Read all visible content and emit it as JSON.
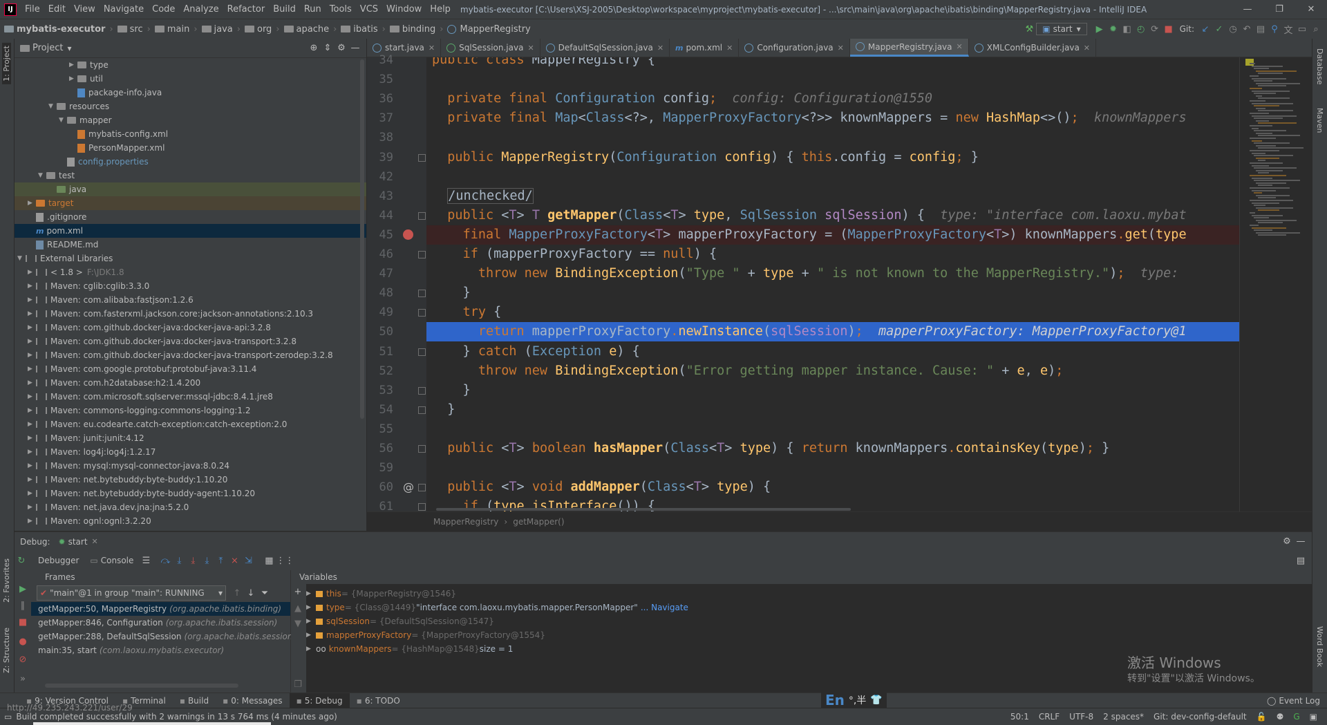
{
  "window": {
    "title": "mybatis-executor [C:\\Users\\XSJ-2005\\Desktop\\workspace\\myproject\\mybatis-executor] - ...\\src\\main\\java\\org\\apache\\ibatis\\binding\\MapperRegistry.java - IntelliJ IDEA",
    "logo": "IJ"
  },
  "menu": [
    "File",
    "Edit",
    "View",
    "Navigate",
    "Code",
    "Analyze",
    "Refactor",
    "Build",
    "Run",
    "Tools",
    "VCS",
    "Window",
    "Help"
  ],
  "breadcrumb": {
    "project": "mybatis-executor",
    "items": [
      "src",
      "main",
      "java",
      "org",
      "apache",
      "ibatis",
      "binding",
      "MapperRegistry"
    ]
  },
  "toolbar": {
    "run_config": "start",
    "git_label": "Git:"
  },
  "left_strip": {
    "project": "1: Project",
    "favorites": "2: Favorites",
    "structure": "Z: Structure"
  },
  "right_strip": {
    "database": "Database",
    "maven": "Maven",
    "wordbook": "Word Book"
  },
  "project_panel": {
    "title": "Project",
    "rows": [
      {
        "label": "type",
        "indent": 5,
        "kind": "folder",
        "arrow": "▶"
      },
      {
        "label": "util",
        "indent": 5,
        "kind": "folder",
        "arrow": "▶"
      },
      {
        "label": "package-info.java",
        "indent": 5,
        "kind": "java",
        "arrow": ""
      },
      {
        "label": "resources",
        "indent": 3,
        "kind": "folder",
        "arrow": "▼"
      },
      {
        "label": "mapper",
        "indent": 4,
        "kind": "folder",
        "arrow": "▼"
      },
      {
        "label": "mybatis-config.xml",
        "indent": 5,
        "kind": "xml",
        "arrow": ""
      },
      {
        "label": "PersonMapper.xml",
        "indent": 5,
        "kind": "xml",
        "arrow": ""
      },
      {
        "label": "config.properties",
        "indent": 4,
        "kind": "props",
        "arrow": ""
      },
      {
        "label": "test",
        "indent": 2,
        "kind": "folder",
        "arrow": "▼"
      },
      {
        "label": "java",
        "indent": 3,
        "kind": "folder-green",
        "arrow": "",
        "style": "test"
      },
      {
        "label": "target",
        "indent": 1,
        "kind": "folder-orange",
        "arrow": "▶",
        "style": "target"
      },
      {
        "label": ".gitignore",
        "indent": 1,
        "kind": "txt",
        "arrow": ""
      },
      {
        "label": "pom.xml",
        "indent": 1,
        "kind": "maven",
        "arrow": "",
        "style": "sel"
      },
      {
        "label": "README.md",
        "indent": 1,
        "kind": "md",
        "arrow": ""
      },
      {
        "label": "External Libraries",
        "indent": 0,
        "kind": "lib",
        "arrow": "▼"
      },
      {
        "label": "< 1.8 >",
        "suffix": "F:\\JDK1.8",
        "indent": 1,
        "kind": "lib",
        "arrow": "▶"
      },
      {
        "label": "Maven: cglib:cglib:3.3.0",
        "indent": 1,
        "kind": "lib",
        "arrow": "▶"
      },
      {
        "label": "Maven: com.alibaba:fastjson:1.2.6",
        "indent": 1,
        "kind": "lib",
        "arrow": "▶"
      },
      {
        "label": "Maven: com.fasterxml.jackson.core:jackson-annotations:2.10.3",
        "indent": 1,
        "kind": "lib",
        "arrow": "▶"
      },
      {
        "label": "Maven: com.github.docker-java:docker-java-api:3.2.8",
        "indent": 1,
        "kind": "lib",
        "arrow": "▶"
      },
      {
        "label": "Maven: com.github.docker-java:docker-java-transport:3.2.8",
        "indent": 1,
        "kind": "lib",
        "arrow": "▶"
      },
      {
        "label": "Maven: com.github.docker-java:docker-java-transport-zerodep:3.2.8",
        "indent": 1,
        "kind": "lib",
        "arrow": "▶"
      },
      {
        "label": "Maven: com.google.protobuf:protobuf-java:3.11.4",
        "indent": 1,
        "kind": "lib",
        "arrow": "▶"
      },
      {
        "label": "Maven: com.h2database:h2:1.4.200",
        "indent": 1,
        "kind": "lib",
        "arrow": "▶"
      },
      {
        "label": "Maven: com.microsoft.sqlserver:mssql-jdbc:8.4.1.jre8",
        "indent": 1,
        "kind": "lib",
        "arrow": "▶"
      },
      {
        "label": "Maven: commons-logging:commons-logging:1.2",
        "indent": 1,
        "kind": "lib",
        "arrow": "▶"
      },
      {
        "label": "Maven: eu.codearte.catch-exception:catch-exception:2.0",
        "indent": 1,
        "kind": "lib",
        "arrow": "▶"
      },
      {
        "label": "Maven: junit:junit:4.12",
        "indent": 1,
        "kind": "lib",
        "arrow": "▶"
      },
      {
        "label": "Maven: log4j:log4j:1.2.17",
        "indent": 1,
        "kind": "lib",
        "arrow": "▶"
      },
      {
        "label": "Maven: mysql:mysql-connector-java:8.0.24",
        "indent": 1,
        "kind": "lib",
        "arrow": "▶"
      },
      {
        "label": "Maven: net.bytebuddy:byte-buddy:1.10.20",
        "indent": 1,
        "kind": "lib",
        "arrow": "▶"
      },
      {
        "label": "Maven: net.bytebuddy:byte-buddy-agent:1.10.20",
        "indent": 1,
        "kind": "lib",
        "arrow": "▶"
      },
      {
        "label": "Maven: net.java.dev.jna:jna:5.2.0",
        "indent": 1,
        "kind": "lib",
        "arrow": "▶"
      },
      {
        "label": "Maven: ognl:ognl:3.2.20",
        "indent": 1,
        "kind": "lib",
        "arrow": "▶"
      }
    ]
  },
  "tabs": [
    {
      "label": "start.java",
      "icon": "class",
      "active": false
    },
    {
      "label": "SqlSession.java",
      "icon": "interface",
      "active": false
    },
    {
      "label": "DefaultSqlSession.java",
      "icon": "class",
      "active": false
    },
    {
      "label": "pom.xml",
      "icon": "maven",
      "active": false
    },
    {
      "label": "Configuration.java",
      "icon": "class",
      "active": false
    },
    {
      "label": "MapperRegistry.java",
      "icon": "class",
      "active": true
    },
    {
      "label": "XMLConfigBuilder.java",
      "icon": "class",
      "active": false
    }
  ],
  "editor": {
    "lines": [
      {
        "n": "34",
        "html": "<span class=\"kw\">public class</span> MapperRegistry {"
      },
      {
        "n": "35",
        "html": ""
      },
      {
        "n": "36",
        "html": "  <span class=\"kw\">private final</span> <span class=\"ty\">Configuration</span> config<span class=\"kw\">;</span>  <span class=\"hint\">config: Configuration@1550</span>"
      },
      {
        "n": "37",
        "html": "  <span class=\"kw\">private final</span> <span class=\"ty\">Map</span>&lt;<span class=\"ty\">Class</span>&lt;?&gt;, <span class=\"ty\">MapperProxyFactory</span>&lt;?&gt;&gt; knownMappers = <span class=\"kw\">new</span> <span class=\"fnn\">HashMap</span>&lt;&gt;()<span class=\"kw\">;</span>  <span class=\"hint\">knownMappers</span>"
      },
      {
        "n": "38",
        "html": ""
      },
      {
        "n": "39",
        "html": "  <span class=\"kw\">public</span> <span class=\"fnn\">MapperRegistry</span>(<span class=\"ty\">Configuration</span> <span class=\"fnn\">config</span>) { <span class=\"kw\">this</span>.config = <span class=\"fnn\">config</span><span class=\"kw\">;</span> }"
      },
      {
        "n": "42",
        "html": ""
      },
      {
        "n": "43",
        "html": "  <span class=\"hint\" style=\"font-style:normal;color:#a9b7c6;border:1px solid #5a5a5a;\">/unchecked/</span>"
      },
      {
        "n": "44",
        "html": "  <span class=\"kw\">public</span> &lt;<span class=\"ty2\">T</span>&gt; <span class=\"ty2\">T</span> <span class=\"fn\">getMapper</span>(<span class=\"ty\">Class</span>&lt;<span class=\"ty2\">T</span>&gt; <span class=\"fnn\">type</span>, <span class=\"ty\">SqlSession</span> <span class=\"pm\">sqlSession</span>) {  <span class=\"hint\">type: \"interface com.laoxu.mybat</span>"
      },
      {
        "n": "45",
        "html": "    <span class=\"kw\">final</span> <span class=\"ty\">MapperProxyFactory</span>&lt;<span class=\"ty2\">T</span>&gt; mapperProxyFactory = (<span class=\"ty\">MapperProxyFactory</span>&lt;<span class=\"ty2\">T</span>&gt;) knownMappers<span class=\"kw\">.</span><span class=\"fnn\">get</span>(<span class=\"fnn\">type</span>",
        "cls": "bp-line"
      },
      {
        "n": "46",
        "html": "    <span class=\"kw\">if</span> (mapperProxyFactory == <span class=\"kw\">null</span>) {"
      },
      {
        "n": "47",
        "html": "      <span class=\"kw\">throw new</span> <span class=\"fnn\">BindingException</span>(<span class=\"st\">\"Type \"</span> + <span class=\"fnn\">type</span> + <span class=\"st\">\" is not known to the MapperRegistry.\"</span>)<span class=\"kw\">;</span>  <span class=\"hint\">type:</span>"
      },
      {
        "n": "48",
        "html": "    }"
      },
      {
        "n": "49",
        "html": "    <span class=\"kw\">try</span> {"
      },
      {
        "n": "50",
        "html": "      <span class=\"kw\">return</span> mapperProxyFactory<span class=\"kw\">.</span><span class=\"fnn\">newInstance</span>(<span class=\"pm\">sqlSession</span>)<span class=\"kw\">;</span>  <span class=\"hint\" style=\"color:#d0d0d0\">mapperProxyFactory: MapperProxyFactory@1</span>",
        "cls": "hl-line"
      },
      {
        "n": "51",
        "html": "    } <span class=\"kw\">catch</span> (<span class=\"ty\">Exception</span> <span class=\"fnn\">e</span>) {"
      },
      {
        "n": "52",
        "html": "      <span class=\"kw\">throw new</span> <span class=\"fnn\">BindingException</span>(<span class=\"st\">\"Error getting mapper instance. Cause: \"</span> + <span class=\"fnn\">e</span>, <span class=\"fnn\">e</span>)<span class=\"kw\">;</span>"
      },
      {
        "n": "53",
        "html": "    }"
      },
      {
        "n": "54",
        "html": "  }"
      },
      {
        "n": "55",
        "html": ""
      },
      {
        "n": "56",
        "html": "  <span class=\"kw\">public</span> &lt;<span class=\"ty2\">T</span>&gt; <span class=\"kw\">boolean</span> <span class=\"fn\">hasMapper</span>(<span class=\"ty\">Class</span>&lt;<span class=\"ty2\">T</span>&gt; <span class=\"fnn\">type</span>) { <span class=\"kw\">return</span> knownMappers<span class=\"kw\">.</span><span class=\"fnn\">containsKey</span>(<span class=\"fnn\">type</span>)<span class=\"kw\">;</span> }"
      },
      {
        "n": "59",
        "html": ""
      },
      {
        "n": "60",
        "html": "  <span class=\"kw\">public</span> &lt;<span class=\"ty2\">T</span>&gt; <span class=\"kw\">void</span> <span class=\"fn\">addMapper</span>(<span class=\"ty\">Class</span>&lt;<span class=\"ty2\">T</span>&gt; <span class=\"fnn\">type</span>) {"
      },
      {
        "n": "61",
        "html": "    <span class=\"kw\">if</span> (<span class=\"fnn\">type</span><span class=\"kw\">.</span><span class=\"fnn\">isInterface</span>()) {"
      }
    ],
    "status_crumb": [
      "MapperRegistry",
      "getMapper()"
    ]
  },
  "debug": {
    "title": "Debug:",
    "session_tab": "start",
    "debugger_tab": "Debugger",
    "console_tab": "Console",
    "frames_label": "Frames",
    "variables_label": "Variables",
    "thread": "\"main\"@1 in group \"main\": RUNNING",
    "frames": [
      {
        "method": "getMapper:50, MapperRegistry",
        "pkg": "(org.apache.ibatis.binding)",
        "sel": true
      },
      {
        "method": "getMapper:846, Configuration",
        "pkg": "(org.apache.ibatis.session)",
        "sel": false
      },
      {
        "method": "getMapper:288, DefaultSqlSession",
        "pkg": "(org.apache.ibatis.session)",
        "sel": false
      },
      {
        "method": "main:35, start",
        "pkg": "(com.laoxu.mybatis.executor)",
        "sel": false
      }
    ],
    "variables": [
      {
        "name": "this",
        "val": " = {MapperRegistry@1546}",
        "extra": "",
        "link": ""
      },
      {
        "name": "type",
        "val": " = {Class@1449} ",
        "extra": "\"interface com.laoxu.mybatis.mapper.PersonMapper\"",
        "link": "... Navigate"
      },
      {
        "name": "sqlSession",
        "val": " = {DefaultSqlSession@1547}",
        "extra": "",
        "link": ""
      },
      {
        "name": "mapperProxyFactory",
        "val": " = {MapperProxyFactory@1554}",
        "extra": "",
        "link": ""
      },
      {
        "name": "knownMappers",
        "val": " = {HashMap@1548} ",
        "extra": " size = 1",
        "link": "",
        "oo": true
      }
    ]
  },
  "bottom_tabs": [
    {
      "label": "9: Version Control",
      "active": false
    },
    {
      "label": "Terminal",
      "active": false
    },
    {
      "label": "Build",
      "active": false
    },
    {
      "label": "0: Messages",
      "active": false
    },
    {
      "label": "5: Debug",
      "active": true
    },
    {
      "label": "6: TODO",
      "active": false
    }
  ],
  "event_log": "Event Log",
  "status": {
    "message": "Build completed successfully with 2 warnings in 13 s 764 ms (4 minutes ago)",
    "url_overlay": "http://49.235.243.221/user/29",
    "position": "50:1",
    "line_sep": "CRLF",
    "encoding": "UTF-8",
    "indent": "2 spaces*",
    "git": "Git: dev-config-default"
  },
  "ime": {
    "lang": "En",
    "marks": "°,半"
  },
  "activate_windows": {
    "line1": "激活 Windows",
    "line2": "转到\"设置\"以激活 Windows。"
  }
}
